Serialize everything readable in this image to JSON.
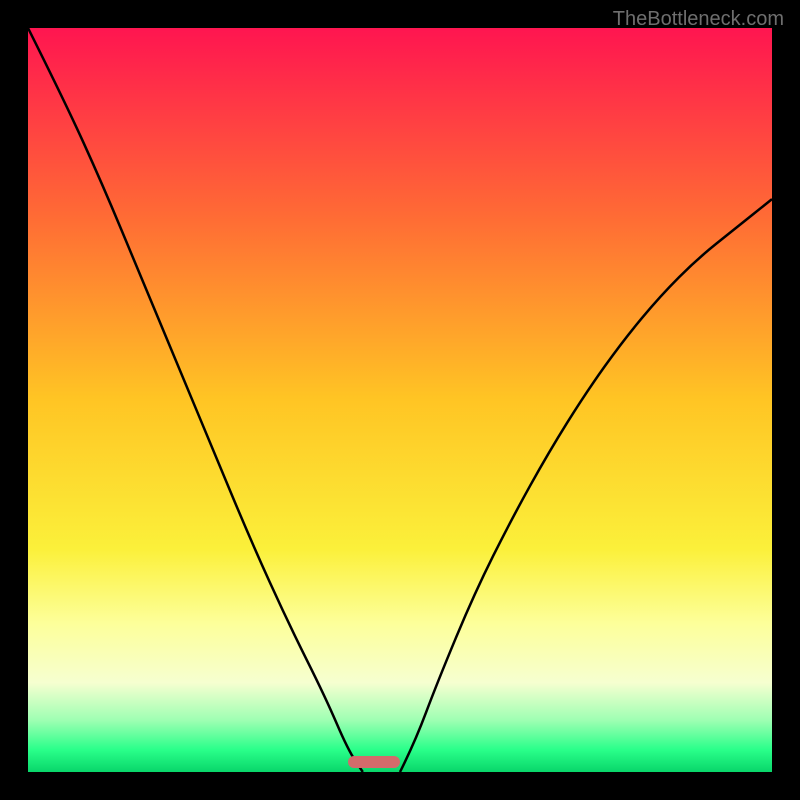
{
  "watermark": "TheBottleneck.com",
  "chart_data": {
    "type": "line",
    "title": "",
    "xlabel": "",
    "ylabel": "",
    "xlim": [
      0,
      100
    ],
    "ylim": [
      0,
      100
    ],
    "series": [
      {
        "name": "left-curve",
        "x": [
          0,
          5,
          10,
          15,
          20,
          25,
          30,
          35,
          40,
          43,
          45
        ],
        "values": [
          100,
          90,
          79,
          67,
          55,
          43,
          31,
          20,
          10,
          3,
          0
        ]
      },
      {
        "name": "right-curve",
        "x": [
          50,
          52,
          55,
          60,
          65,
          70,
          75,
          80,
          85,
          90,
          95,
          100
        ],
        "values": [
          0,
          4,
          12,
          24,
          34,
          43,
          51,
          58,
          64,
          69,
          73,
          77
        ]
      }
    ],
    "gradient_stops": [
      {
        "offset": 0,
        "color": "#ff1550"
      },
      {
        "offset": 25,
        "color": "#ff6a35"
      },
      {
        "offset": 50,
        "color": "#ffc524"
      },
      {
        "offset": 70,
        "color": "#fbf03a"
      },
      {
        "offset": 80,
        "color": "#fdff9a"
      },
      {
        "offset": 88,
        "color": "#f6ffd0"
      },
      {
        "offset": 93,
        "color": "#9fffb3"
      },
      {
        "offset": 97,
        "color": "#2aff8a"
      },
      {
        "offset": 100,
        "color": "#09d66a"
      }
    ],
    "marker": {
      "x_start": 43,
      "x_end": 50,
      "color": "#d36b6b"
    }
  }
}
